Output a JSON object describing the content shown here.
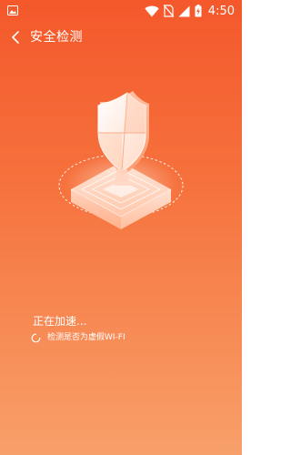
{
  "status_bar": {
    "time": "4:50",
    "icons": [
      "gallery-icon",
      "wifi-icon",
      "no-sim-icon",
      "signal-icon",
      "battery-charging-icon"
    ]
  },
  "header": {
    "back_icon": "chevron-left-icon",
    "title": "安全检测"
  },
  "illustration": {
    "icon": "shield-on-platform-icon"
  },
  "progress": {
    "title": "正在加速...",
    "current_check": "检测是否为虚假WI-FI",
    "spinner_icon": "loading-spinner-icon"
  },
  "colors": {
    "gradient_top": "#f4582b",
    "gradient_mid": "#f6733e",
    "gradient_bottom": "#f8a06a",
    "text": "#ffffff"
  }
}
